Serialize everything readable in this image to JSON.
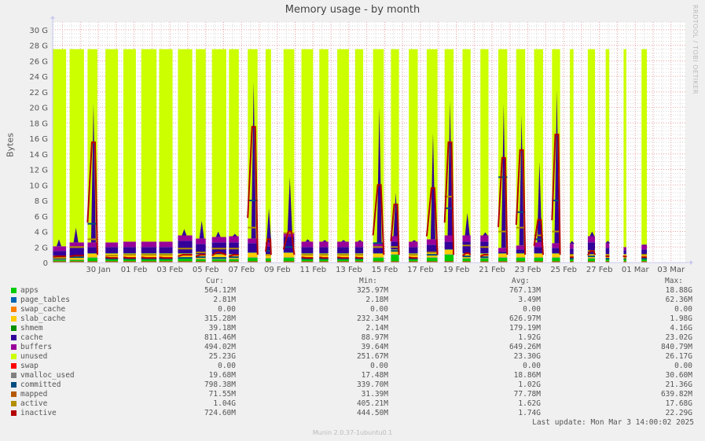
{
  "title": "Memory usage - by month",
  "vertical_label": "Bytes",
  "watermark": "RRDTOOL / TOBI OETIKER",
  "footer": "Munin 2.0.37-1ubuntu0.1",
  "last_update": "Last update: Mon Mar  3 14:00:02 2025",
  "legend_headers": {
    "cur": "Cur:",
    "min": "Min:",
    "avg": "Avg:",
    "max": "Max:"
  },
  "legend": [
    {
      "name": "apps",
      "color": "#00cc00",
      "cur": "564.12M",
      "min": "325.97M",
      "avg": "767.13M",
      "max": "18.88G"
    },
    {
      "name": "page_tables",
      "color": "#0066b3",
      "cur": "2.81M",
      "min": "2.18M",
      "avg": "3.49M",
      "max": "62.36M"
    },
    {
      "name": "swap_cache",
      "color": "#ff8000",
      "cur": "0.00",
      "min": "0.00",
      "avg": "0.00",
      "max": "0.00"
    },
    {
      "name": "slab_cache",
      "color": "#ffcc00",
      "cur": "315.28M",
      "min": "232.34M",
      "avg": "626.97M",
      "max": "1.98G"
    },
    {
      "name": "shmem",
      "color": "#008f00",
      "cur": "39.18M",
      "min": "2.14M",
      "avg": "179.19M",
      "max": "4.16G"
    },
    {
      "name": "cache",
      "color": "#330099",
      "cur": "811.46M",
      "min": "88.97M",
      "avg": "1.92G",
      "max": "23.02G"
    },
    {
      "name": "buffers",
      "color": "#990099",
      "cur": "494.02M",
      "min": "39.64M",
      "avg": "649.26M",
      "max": "840.79M"
    },
    {
      "name": "unused",
      "color": "#ccff00",
      "cur": "25.23G",
      "min": "251.67M",
      "avg": "23.30G",
      "max": "26.17G"
    },
    {
      "name": "swap",
      "color": "#ff0000",
      "cur": "0.00",
      "min": "0.00",
      "avg": "0.00",
      "max": "0.00"
    },
    {
      "name": "vmalloc_used",
      "color": "#808080",
      "cur": "19.68M",
      "min": "17.48M",
      "avg": "18.86M",
      "max": "30.60M"
    },
    {
      "name": "committed",
      "color": "#004d80",
      "cur": "798.38M",
      "min": "339.70M",
      "avg": "1.02G",
      "max": "21.36G"
    },
    {
      "name": "mapped",
      "color": "#b35a00",
      "cur": "71.55M",
      "min": "31.39M",
      "avg": "77.78M",
      "max": "639.82M"
    },
    {
      "name": "active",
      "color": "#b38f00",
      "cur": "1.04G",
      "min": "405.21M",
      "avg": "1.62G",
      "max": "17.68G"
    },
    {
      "name": "inactive",
      "color": "#b30000",
      "cur": "724.60M",
      "min": "444.50M",
      "avg": "1.74G",
      "max": "22.29G"
    }
  ],
  "chart_data": {
    "type": "area",
    "title": "Memory usage - by month",
    "xlabel": "",
    "ylabel": "Bytes",
    "ylim": [
      0,
      31
    ],
    "y_unit": "G",
    "y_ticks": [
      0,
      2,
      4,
      6,
      8,
      10,
      12,
      14,
      16,
      18,
      20,
      22,
      24,
      26,
      28,
      30
    ],
    "y_tick_labels": [
      "0",
      "2 G",
      "4 G",
      "6 G",
      "8 G",
      "10 G",
      "12 G",
      "14 G",
      "16 G",
      "18 G",
      "20 G",
      "22 G",
      "24 G",
      "26 G",
      "28 G",
      "30 G"
    ],
    "x_range_days": [
      -2.55,
      32.8
    ],
    "x_ticks": [
      0,
      2,
      4,
      6,
      8,
      10,
      12,
      14,
      16,
      18,
      20,
      22,
      24,
      26,
      28,
      30,
      32
    ],
    "x_tick_labels": [
      "30 Jan",
      "01 Feb",
      "03 Feb",
      "05 Feb",
      "07 Feb",
      "09 Feb",
      "11 Feb",
      "13 Feb",
      "15 Feb",
      "17 Feb",
      "19 Feb",
      "21 Feb",
      "23 Feb",
      "25 Feb",
      "27 Feb",
      "01 Mar",
      "03 Mar"
    ],
    "grid": true,
    "total_memory_G": 27.5,
    "stack_order": [
      "apps",
      "page_tables",
      "swap_cache",
      "slab_cache",
      "cache",
      "buffers",
      "unused",
      "swap"
    ],
    "line_series": [
      "vmalloc_used",
      "committed",
      "mapped",
      "active",
      "inactive"
    ],
    "segments": [
      {
        "start": -2.55,
        "end": -1.8,
        "apps": 0.3,
        "slab": 0.5,
        "cache": 0.6,
        "buffers": 0.6,
        "peak_cache": 3.0,
        "inactive": 0.8,
        "active": 0.6,
        "committed": 0.5
      },
      {
        "start": -1.6,
        "end": -0.8,
        "apps": 0.3,
        "slab": 0.5,
        "cache": 1.0,
        "buffers": 0.7,
        "peak_cache": 4.5,
        "inactive": 0.9,
        "active": 2.0,
        "committed": 0.7
      },
      {
        "start": -0.6,
        "end": -0.05,
        "apps": 0.6,
        "slab": 0.5,
        "cache": 0.8,
        "buffers": 0.6,
        "peak_cache": 20.5,
        "inactive": 15.5,
        "active": 3.0,
        "committed": 5.0
      },
      {
        "start": 0.4,
        "end": 1.1,
        "apps": 0.5,
        "slab": 0.6,
        "cache": 0.8,
        "buffers": 0.6,
        "peak_cache": 2.6,
        "inactive": 0.6,
        "active": 0.9,
        "committed": 0.5
      },
      {
        "start": 1.4,
        "end": 2.1,
        "apps": 0.5,
        "slab": 0.6,
        "cache": 0.8,
        "buffers": 0.7,
        "peak_cache": 2.7,
        "inactive": 0.6,
        "active": 1.0,
        "committed": 0.5
      },
      {
        "start": 2.4,
        "end": 3.25,
        "apps": 0.5,
        "slab": 0.6,
        "cache": 0.8,
        "buffers": 0.7,
        "peak_cache": 2.7,
        "inactive": 0.6,
        "active": 1.0,
        "committed": 0.5
      },
      {
        "start": 3.4,
        "end": 4.15,
        "apps": 0.5,
        "slab": 0.6,
        "cache": 0.8,
        "buffers": 0.7,
        "peak_cache": 2.7,
        "inactive": 0.6,
        "active": 1.0,
        "committed": 0.5
      },
      {
        "start": 4.45,
        "end": 5.25,
        "apps": 0.5,
        "slab": 0.6,
        "cache": 1.6,
        "buffers": 0.7,
        "peak_cache": 4.3,
        "inactive": 1.0,
        "active": 1.8,
        "committed": 0.6
      },
      {
        "start": 5.45,
        "end": 6.0,
        "apps": 0.4,
        "slab": 0.6,
        "cache": 1.3,
        "buffers": 0.7,
        "peak_cache": 5.4,
        "inactive": 1.0,
        "active": 1.3,
        "committed": 0.7
      },
      {
        "start": 6.35,
        "end": 7.15,
        "apps": 0.4,
        "slab": 0.6,
        "cache": 1.5,
        "buffers": 0.7,
        "peak_cache": 4.0,
        "inactive": 1.3,
        "active": 1.8,
        "committed": 0.6
      },
      {
        "start": 7.3,
        "end": 7.85,
        "apps": 0.4,
        "slab": 0.6,
        "cache": 1.5,
        "buffers": 0.8,
        "peak_cache": 3.7,
        "inactive": 1.0,
        "active": 1.8,
        "committed": 0.7
      },
      {
        "start": 8.35,
        "end": 8.9,
        "apps": 0.6,
        "slab": 0.6,
        "cache": 1.2,
        "buffers": 0.6,
        "peak_cache": 23.3,
        "inactive": 17.5,
        "active": 4.5,
        "committed": 8.0
      },
      {
        "start": 9.35,
        "end": 9.65,
        "apps": 0.5,
        "slab": 0.5,
        "cache": 1.0,
        "buffers": 0.5,
        "peak_cache": 7.0,
        "inactive": 3.0,
        "active": 1.0,
        "committed": 1.5
      },
      {
        "start": 10.35,
        "end": 10.95,
        "apps": 0.6,
        "slab": 0.6,
        "cache": 2.0,
        "buffers": 0.6,
        "peak_cache": 11.0,
        "inactive": 4.0,
        "active": 3.8,
        "committed": 2.0
      },
      {
        "start": 11.35,
        "end": 12.0,
        "apps": 0.5,
        "slab": 0.6,
        "cache": 0.8,
        "buffers": 0.7,
        "peak_cache": 3.0,
        "inactive": 0.6,
        "active": 1.0,
        "committed": 0.5
      },
      {
        "start": 12.35,
        "end": 12.85,
        "apps": 0.5,
        "slab": 0.6,
        "cache": 0.8,
        "buffers": 0.7,
        "peak_cache": 2.9,
        "inactive": 0.6,
        "active": 1.0,
        "committed": 0.5
      },
      {
        "start": 13.35,
        "end": 14.0,
        "apps": 0.5,
        "slab": 0.6,
        "cache": 0.8,
        "buffers": 0.7,
        "peak_cache": 2.9,
        "inactive": 0.6,
        "active": 1.0,
        "committed": 0.5
      },
      {
        "start": 14.35,
        "end": 14.8,
        "apps": 0.5,
        "slab": 0.6,
        "cache": 0.8,
        "buffers": 0.7,
        "peak_cache": 2.9,
        "inactive": 0.6,
        "active": 1.0,
        "committed": 0.5
      },
      {
        "start": 15.35,
        "end": 15.95,
        "apps": 0.6,
        "slab": 0.5,
        "cache": 0.7,
        "buffers": 0.6,
        "peak_cache": 20.0,
        "inactive": 10.0,
        "active": 2.0,
        "committed": 2.5
      },
      {
        "start": 16.35,
        "end": 16.8,
        "apps": 1.0,
        "slab": 0.6,
        "cache": 1.0,
        "buffers": 0.7,
        "peak_cache": 9.0,
        "inactive": 7.5,
        "active": 2.0,
        "committed": 1.5
      },
      {
        "start": 17.35,
        "end": 17.85,
        "apps": 0.5,
        "slab": 0.6,
        "cache": 0.8,
        "buffers": 0.7,
        "peak_cache": 2.9,
        "inactive": 0.6,
        "active": 1.0,
        "committed": 0.5
      },
      {
        "start": 18.35,
        "end": 18.95,
        "apps": 0.6,
        "slab": 0.6,
        "cache": 1.0,
        "buffers": 0.7,
        "peak_cache": 16.7,
        "inactive": 9.6,
        "active": 1.3,
        "committed": 1.0
      },
      {
        "start": 19.35,
        "end": 19.85,
        "apps": 1.0,
        "slab": 0.6,
        "cache": 1.0,
        "buffers": 0.8,
        "peak_cache": 20.8,
        "inactive": 15.5,
        "active": 8.5,
        "committed": 7.0
      },
      {
        "start": 20.35,
        "end": 20.8,
        "apps": 0.5,
        "slab": 0.6,
        "cache": 1.5,
        "buffers": 0.8,
        "peak_cache": 6.4,
        "inactive": 1.2,
        "active": 2.2,
        "committed": 0.8
      },
      {
        "start": 21.35,
        "end": 21.8,
        "apps": 0.5,
        "slab": 0.6,
        "cache": 1.5,
        "buffers": 0.8,
        "peak_cache": 3.9,
        "inactive": 1.0,
        "active": 2.0,
        "committed": 0.7
      },
      {
        "start": 22.35,
        "end": 22.85,
        "apps": 0.6,
        "slab": 0.5,
        "cache": 0.2,
        "buffers": 0.5,
        "peak_cache": 20.4,
        "inactive": 13.5,
        "active": 4.0,
        "committed": 11.0
      },
      {
        "start": 23.35,
        "end": 23.85,
        "apps": 0.6,
        "slab": 0.5,
        "cache": 0.5,
        "buffers": 0.5,
        "peak_cache": 19.0,
        "inactive": 14.5,
        "active": 4.5,
        "committed": 6.5
      },
      {
        "start": 24.35,
        "end": 24.85,
        "apps": 0.6,
        "slab": 0.5,
        "cache": 0.8,
        "buffers": 0.6,
        "peak_cache": 13.0,
        "inactive": 5.5,
        "active": 3.5,
        "committed": 3.0
      },
      {
        "start": 25.35,
        "end": 25.8,
        "apps": 0.6,
        "slab": 0.5,
        "cache": 0.7,
        "buffers": 0.6,
        "peak_cache": 22.2,
        "inactive": 16.5,
        "active": 4.0,
        "committed": 8.0
      },
      {
        "start": 26.35,
        "end": 26.55,
        "apps": 0.5,
        "slab": 0.5,
        "cache": 0.7,
        "buffers": 0.6,
        "peak_cache": 2.8,
        "inactive": 0.7,
        "active": 1.0,
        "committed": 0.5
      },
      {
        "start": 27.35,
        "end": 27.75,
        "apps": 0.5,
        "slab": 0.5,
        "cache": 1.5,
        "buffers": 0.8,
        "peak_cache": 4.0,
        "inactive": 1.5,
        "active": 1.5,
        "committed": 0.8
      },
      {
        "start": 28.35,
        "end": 28.55,
        "apps": 0.5,
        "slab": 0.5,
        "cache": 0.8,
        "buffers": 0.6,
        "peak_cache": 2.8,
        "inactive": 0.8,
        "active": 1.0,
        "committed": 0.5
      },
      {
        "start": 29.35,
        "end": 29.5,
        "apps": 0.5,
        "slab": 0.5,
        "cache": 0.5,
        "buffers": 0.4,
        "peak_cache": 2.0,
        "inactive": 0.8,
        "active": 0.6,
        "committed": 0.5
      },
      {
        "start": 30.35,
        "end": 30.65,
        "apps": 0.5,
        "slab": 0.5,
        "cache": 0.6,
        "buffers": 0.6,
        "peak_cache": 2.2,
        "inactive": 0.7,
        "active": 1.0,
        "committed": 0.5
      }
    ]
  }
}
